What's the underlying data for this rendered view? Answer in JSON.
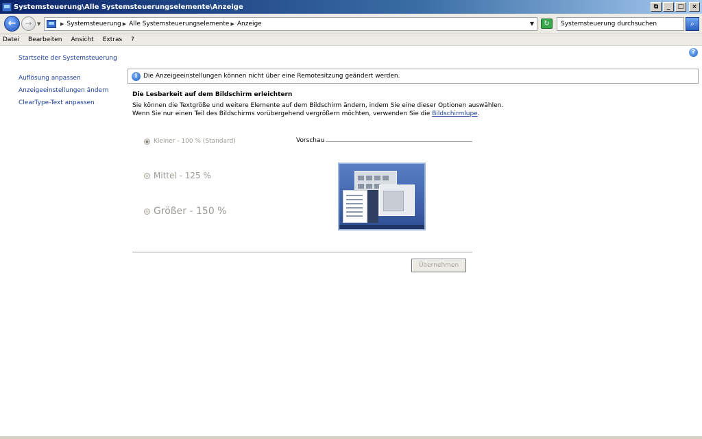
{
  "window": {
    "title": "Systemsteuerung\\Alle Systemsteuerungselemente\\Anzeige",
    "buttons": {
      "restore": "⧉",
      "minimize": "_",
      "maximize": "□",
      "close": "×"
    }
  },
  "address": {
    "breadcrumbs": [
      "Systemsteuerung",
      "Alle Systemsteuerungselemente",
      "Anzeige"
    ],
    "search_placeholder": "Systemsteuerung durchsuchen"
  },
  "menu": [
    "Datei",
    "Bearbeiten",
    "Ansicht",
    "Extras",
    "?"
  ],
  "sidebar": {
    "home": "Startseite der Systemsteuerung",
    "links": [
      "Auflösung anpassen",
      "Anzeigeeinstellungen ändern",
      "ClearType-Text anpassen"
    ]
  },
  "info": {
    "text": "Die Anzeigeeinstellungen können nicht über eine Remotesitzung geändert werden."
  },
  "main": {
    "heading": "Die Lesbarkeit auf dem Bildschirm erleichtern",
    "desc_line1": "Sie können die Textgröße und weitere Elemente auf dem Bildschirm ändern, indem Sie eine dieser Optionen auswählen.",
    "desc_line2_prefix": "Wenn Sie nur einen Teil des Bildschirms vorübergehend vergrößern möchten, verwenden Sie die ",
    "desc_link": "Bildschirmlupe",
    "desc_line2_suffix": ".",
    "options": [
      {
        "label": "Kleiner - 100 % (Standard)",
        "checked": true
      },
      {
        "label": "Mittel - 125 %",
        "checked": false
      },
      {
        "label": "Größer - 150 %",
        "checked": false
      }
    ],
    "preview_label": "Vorschau",
    "apply_label": "Übernehmen"
  },
  "icons": {
    "back": "back-arrow-icon",
    "forward": "forward-arrow-icon",
    "refresh": "refresh-icon",
    "search": "search-icon",
    "help": "help-icon",
    "info": "info-icon"
  }
}
